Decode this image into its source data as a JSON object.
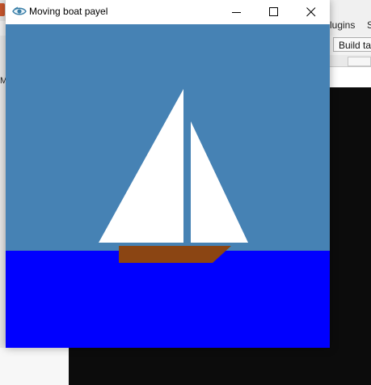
{
  "background_ide": {
    "menu_fragment": "lugins",
    "menu_fragment_2": "S",
    "toolbar_button_fragment": "Build tar",
    "side_letter": "M"
  },
  "window": {
    "title": "Moving boat payel",
    "icon": "app-eye-icon",
    "controls": {
      "minimize_icon": "minimize-icon",
      "maximize_icon": "maximize-icon",
      "close_icon": "close-icon"
    }
  },
  "scene": {
    "sky_color": "#4682B4",
    "sea_color": "#0000FF",
    "sail_color": "#FFFFFF",
    "hull_color": "#8B4513"
  }
}
